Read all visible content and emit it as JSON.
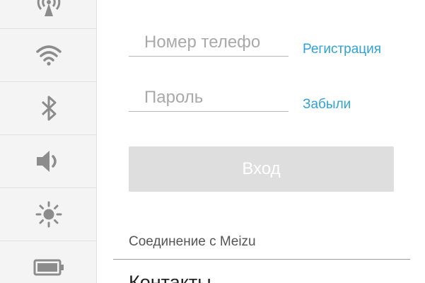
{
  "sidebar": {
    "items": [
      {
        "icon": "antenna-icon"
      },
      {
        "icon": "wifi-icon"
      },
      {
        "icon": "bluetooth-icon"
      },
      {
        "icon": "volume-icon"
      },
      {
        "icon": "brightness-icon"
      },
      {
        "icon": "battery-icon"
      }
    ],
    "icon_color": "#8c8c8c"
  },
  "login": {
    "phone_placeholder": "Номер телефо",
    "register_link": "Регистрация",
    "password_placeholder": "Пароль",
    "forgot_link": "Забыли",
    "login_button": "Вход"
  },
  "section": {
    "title": "Соединение с Meizu",
    "contacts_label": "Контакты"
  },
  "colors": {
    "accent": "#2fa3d8",
    "button_disabled": "#dedede",
    "sidebar_bg": "#f4f4f4"
  }
}
